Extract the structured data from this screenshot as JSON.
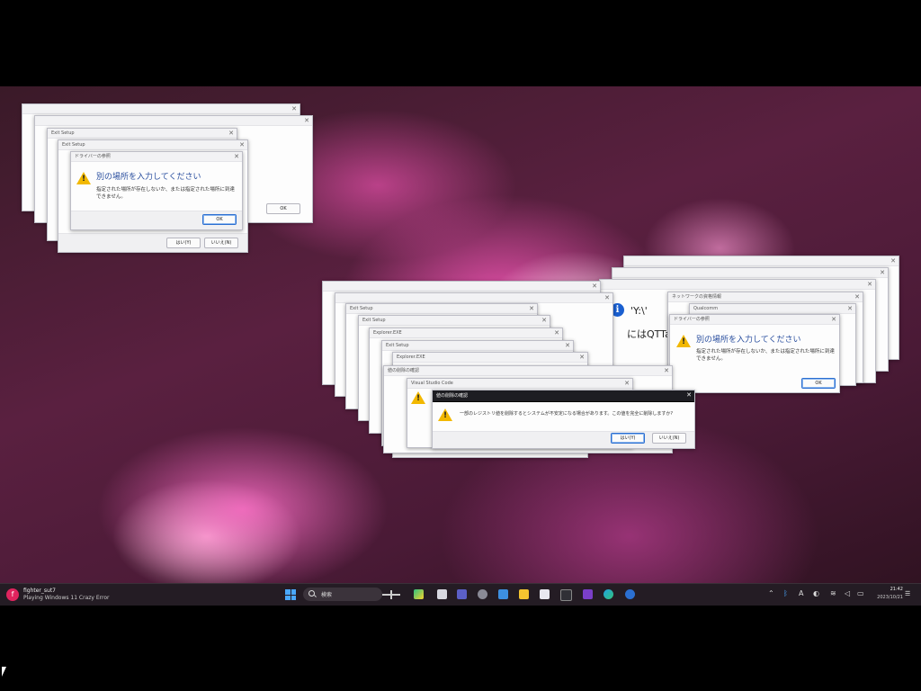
{
  "dialog_text": {
    "driver_title": "ドライバーの参照",
    "drive_header": "別の場所を入力してください",
    "drive_body": "指定された場所が存在しないか、または指定された場所に到達できません。",
    "ok": "OK",
    "yes": "はい(Y)",
    "no": "いいえ(N)",
    "exit_setup": "Exit Setup",
    "explorer": "Explorer.EXE",
    "vscode": "Visual Studio Code",
    "delete_confirm_title": "値の削除の確認",
    "delete_confirm_body": "一部のレジストリ値を削除するとシステムが不安定になる場合があります。この値を完全に削除しますか?",
    "network_title": "ネットワークの資格情報",
    "qttab_title": "'Y:\\'",
    "qttab_body": "にはQTTal",
    "qttab_body2": "Y:\\",
    "qttab_title2": "Qualcomm"
  },
  "taskbar": {
    "user_name": "fighter_sut7",
    "user_initial": "f",
    "status": "Playing Windows 11 Crazy Error",
    "search_placeholder": "検索",
    "time": "21:42",
    "date": "2023/10/21"
  },
  "colors": {
    "accent": "#2b6fd1",
    "warning": "#f2b800",
    "dark_titlebar": "#1d1d22",
    "taskbar_bg": "#241c24"
  }
}
